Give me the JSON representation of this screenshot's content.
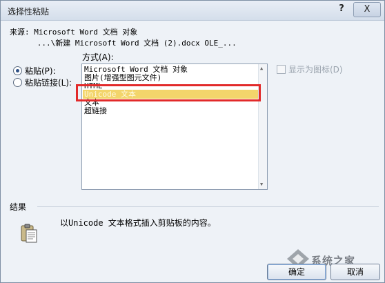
{
  "title": "选择性粘贴",
  "window_buttons": {
    "help": "?",
    "close": "X"
  },
  "source": {
    "line1": "来源: Microsoft Word 文档 对象",
    "line2": "      ...\\新建 Microsoft Word 文档 (2).docx OLE_..."
  },
  "options": [
    {
      "label": "粘贴(P):",
      "checked": true
    },
    {
      "label": "粘贴链接(L):",
      "checked": false
    }
  ],
  "method_label": "方式(A):",
  "formats": [
    "Microsoft Word 文档 对象",
    "图片(增强型图元文件)",
    "HTML",
    "Unicode 文本",
    "文本",
    "超链接"
  ],
  "selected_format_index": 3,
  "display_as_icon": {
    "label": "显示为图标(D)",
    "checked": false
  },
  "result": {
    "heading": "结果",
    "text": "以Unicode 文本格式插入剪贴板的内容。"
  },
  "buttons": {
    "ok": "确定",
    "cancel": "取消"
  },
  "watermark": {
    "text": "系统之家"
  },
  "colors": {
    "selection": "#f3d56b",
    "highlight_box": "#e22a2a"
  }
}
